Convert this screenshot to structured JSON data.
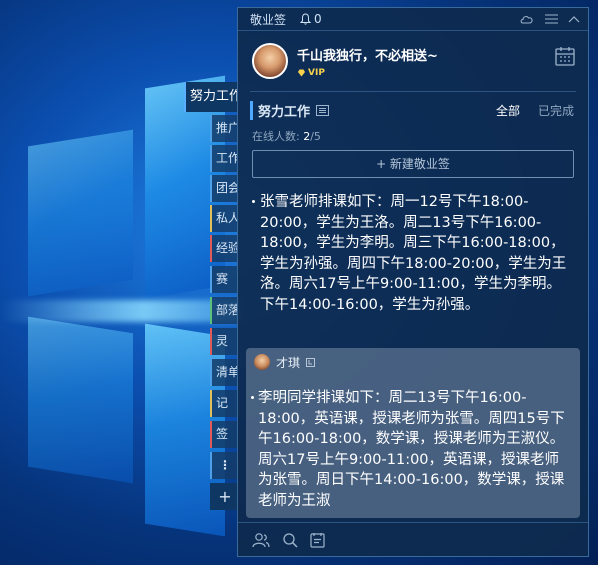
{
  "app": {
    "title": "敬业签",
    "notification_count": "0"
  },
  "user": {
    "signature": "千山我独行，不必相送~",
    "badge": "VIP"
  },
  "group": {
    "title": "努力工作",
    "filter_all": "全部",
    "filter_done": "已完成",
    "online_label": "在线人数:",
    "online_count": "2",
    "online_total": "/5",
    "new_button": "+ 新建敬业签"
  },
  "notes": [
    {
      "text": "张雪老师排课如下：周一12号下午18:00-20:00，学生为王洛。周二13号下午16:00-18:00，学生为李明。周三下午16:00-18:00，学生为孙强。周四下午18:00-20:00，学生为王洛。周六17号上午9:00-11:00，学生为李明。下午14:00-16:00，学生为孙强。"
    },
    {
      "author": "才琪",
      "text": "李明同学排课如下：周二13号下午16:00-18:00，英语课，授课老师为张雪。周四15号下午16:00-18:00，数学课，授课老师为王淑仪。周六17号上午9:00-11:00，英语课，授课老师为张雪。周日下午14:00-16:00，数学课，授课老师为王淑"
    }
  ],
  "side_tabs": {
    "active": "努力工作",
    "items": [
      "推广",
      "工作",
      "团会",
      "私人",
      "经验",
      "赛",
      "部落",
      "灵",
      "清单",
      "记",
      "签",
      "⋮",
      "+"
    ]
  },
  "colors": {
    "panel_bg": "#0e2a4e",
    "accent": "#4ea8ff",
    "vip": "#f7d24a"
  }
}
